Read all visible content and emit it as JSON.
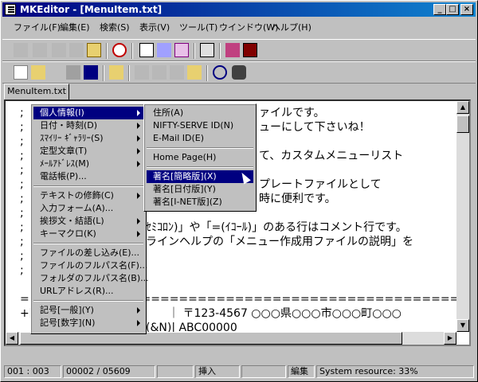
{
  "window": {
    "title": "MKEditor - [MenuItem.txt]"
  },
  "menubar": [
    "ファイル(F)",
    "編集(E)",
    "検索(S)",
    "表示(V)",
    "ツール(T)",
    "ウインドウ(W)",
    "ヘルプ(H)"
  ],
  "tab": "MenuItem.txt",
  "editor_lines": [
    ";",
    ";",
    ";",
    ";",
    ";",
    ";",
    ";",
    ";",
    ";",
    ";",
    ";",
    ";",
    "",
    "=====================================================",
    "+[",
    "",
    "",
    ""
  ],
  "editor_overlay": {
    "l1": "ァイルです。",
    "l2": "ューにして下さいね！",
    "l4": "て、カスタムメニューリスト",
    "l6": "プレートファイルとして",
    "l7": "時に便利です。",
    "l9": "ｾﾐｺﾛﾝ)」や「=(ｲｺｰﾙ)」のある行はコメント行です。",
    "l10": "ラインヘルプの「メニュー作成用ファイルの説明」を",
    "l15": "｜ 〒123-4567 ○○○県○○○市○○○町○○○",
    "l16": "(&N)| ABC00000"
  },
  "menu_main": [
    {
      "label": "個人情報(I)",
      "sub": true,
      "selected": true
    },
    {
      "label": "日付・時刻(D)",
      "sub": true
    },
    {
      "label": "ｽﾏｲﾘｰ ｷﾞｬﾗﾘｰ(S)",
      "sub": true
    },
    {
      "label": "定型文章(T)",
      "sub": true
    },
    {
      "label": "ﾒｰﾙｱﾄﾞﾚｽ(M)",
      "sub": true
    },
    {
      "label": "電話帳(P)...",
      "sub": false
    },
    {
      "sep": true
    },
    {
      "label": "テキストの修飾(C)",
      "sub": true
    },
    {
      "label": "入力フォーム(A)...",
      "sub": false
    },
    {
      "label": "挨拶文・結語(L)",
      "sub": true
    },
    {
      "label": "キーマクロ(K)",
      "sub": true
    },
    {
      "sep": true
    },
    {
      "label": "ファイルの差し込み(E)...",
      "sub": false
    },
    {
      "label": "ファイルのフルパス名(F)...",
      "sub": false
    },
    {
      "label": "フォルダのフルパス名(B)...",
      "sub": false
    },
    {
      "label": "URLアドレス(R)...",
      "sub": false
    },
    {
      "sep": true
    },
    {
      "label": "記号[一般](Y)",
      "sub": true
    },
    {
      "label": "記号[数字](N)",
      "sub": true
    }
  ],
  "menu_sub": [
    {
      "label": "住所(A)"
    },
    {
      "label": "NIFTY-SERVE ID(N)"
    },
    {
      "label": "E-Mail ID(E)"
    },
    {
      "sep": true
    },
    {
      "label": "Home Page(H)"
    },
    {
      "sep": true
    },
    {
      "label": "著名[簡略版](X)",
      "selected": true
    },
    {
      "label": "著名[日付版](Y)"
    },
    {
      "label": "著名[I-NET版](Z)"
    }
  ],
  "status": {
    "pos": "001 : 003",
    "lines": "00002 / 05609",
    "blank1": "",
    "mode": "挿入",
    "blank2": "",
    "edit": "編集",
    "resource": "System resource: 33%"
  }
}
